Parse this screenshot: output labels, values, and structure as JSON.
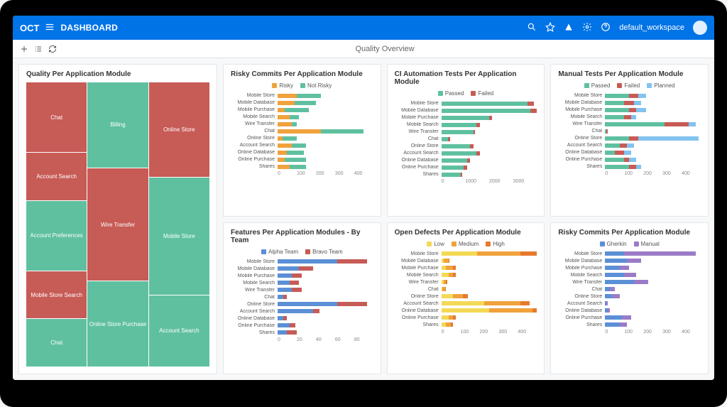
{
  "header": {
    "brand": "OCT",
    "title": "DASHBOARD",
    "workspace": "default_workspace"
  },
  "page": {
    "title": "Quality Overview"
  },
  "colors": {
    "red": "#c75b56",
    "green": "#5fc0a0",
    "orange": "#f0a23c",
    "blue": "#5b8fd6",
    "purple": "#9b7bc6",
    "yellow": "#f3d955",
    "lightblue": "#82c3f0",
    "darkorange": "#e67a2e"
  },
  "chart_data": [
    {
      "type": "treemap",
      "title": "Quality Per Application Module",
      "cells": [
        {
          "col": 0,
          "flex": 3,
          "label": "Chat",
          "color": "red"
        },
        {
          "col": 0,
          "flex": 2,
          "label": "Account Search",
          "color": "red"
        },
        {
          "col": 0,
          "flex": 3,
          "label": "Account Preferences",
          "color": "green"
        },
        {
          "col": 0,
          "flex": 2,
          "label": "Mobile Store Search",
          "color": "red"
        },
        {
          "col": 0,
          "flex": 2,
          "label": "Chat",
          "color": "green"
        },
        {
          "col": 1,
          "flex": 3,
          "label": "Billing",
          "color": "green"
        },
        {
          "col": 1,
          "flex": 4,
          "label": "Wire Transfer",
          "color": "red"
        },
        {
          "col": 1,
          "flex": 3,
          "label": "Online Store Purchase",
          "color": "green"
        },
        {
          "col": 2,
          "flex": 4,
          "label": "Online Store",
          "color": "red"
        },
        {
          "col": 2,
          "flex": 5,
          "label": "Mobile Store",
          "color": "green"
        },
        {
          "col": 2,
          "flex": 3,
          "label": "Account Search",
          "color": "green"
        }
      ]
    },
    {
      "type": "bar",
      "title": "Risky Commits Per Application Module",
      "legend": [
        {
          "name": "Risky",
          "color": "orange"
        },
        {
          "name": "Not Risky",
          "color": "green"
        }
      ],
      "categories": [
        "Mobile Store",
        "Mobile Database",
        "Mobile Purchase",
        "Mobile Search",
        "Wire Transfer",
        "Chat",
        "Online Store",
        "Account Search",
        "Online Database",
        "Online Purchase",
        "Shares"
      ],
      "series": [
        {
          "name": "Risky",
          "color": "orange",
          "values": [
            80,
            70,
            30,
            50,
            60,
            180,
            20,
            60,
            40,
            30,
            50
          ]
        },
        {
          "name": "Not Risky",
          "color": "green",
          "values": [
            100,
            90,
            100,
            40,
            20,
            180,
            60,
            60,
            70,
            90,
            70
          ]
        }
      ],
      "xlim": [
        0,
        400
      ],
      "ticks": [
        0,
        100,
        200,
        300,
        400
      ]
    },
    {
      "type": "bar",
      "title": "CI Automation Tests Per Application Module",
      "legend": [
        {
          "name": "Passed",
          "color": "green"
        },
        {
          "name": "Failed",
          "color": "red"
        }
      ],
      "categories": [
        "Mobile Store",
        "Mobile Database",
        "Mobile Purchase",
        "Mobile Search",
        "Wire Transfer",
        "Chat",
        "Online Store",
        "Account Search",
        "Online Database",
        "Online Purchase",
        "Shares"
      ],
      "series": [
        {
          "name": "Passed",
          "color": "green",
          "values": [
            2700,
            2800,
            1500,
            1100,
            1000,
            200,
            900,
            1100,
            800,
            700,
            600
          ]
        },
        {
          "name": "Failed",
          "color": "red",
          "values": [
            200,
            200,
            100,
            100,
            50,
            80,
            100,
            100,
            100,
            100,
            50
          ]
        }
      ],
      "xlim": [
        0,
        3000
      ],
      "ticks": [
        0,
        1000,
        2000,
        3000
      ]
    },
    {
      "type": "bar",
      "title": "Manual Tests Per Application Module",
      "legend": [
        {
          "name": "Passed",
          "color": "green"
        },
        {
          "name": "Failed",
          "color": "red"
        },
        {
          "name": "Planned",
          "color": "lightblue"
        }
      ],
      "categories": [
        "Mobile Store",
        "Mobile Database",
        "Mobile Purchase",
        "Mobile Search",
        "Wire Transfer",
        "Chat",
        "Online Store",
        "Account Search",
        "Online Database",
        "Online Purchase",
        "Shares"
      ],
      "series": [
        {
          "name": "Passed",
          "color": "green",
          "values": [
            100,
            80,
            100,
            80,
            250,
            5,
            100,
            60,
            40,
            80,
            100
          ]
        },
        {
          "name": "Failed",
          "color": "red",
          "values": [
            40,
            40,
            30,
            30,
            100,
            5,
            40,
            30,
            40,
            20,
            30
          ]
        },
        {
          "name": "Planned",
          "color": "lightblue",
          "values": [
            30,
            30,
            40,
            20,
            30,
            0,
            250,
            30,
            30,
            30,
            20
          ]
        }
      ],
      "xlim": [
        0,
        400
      ],
      "ticks": [
        0,
        100,
        200,
        300,
        400
      ]
    },
    {
      "type": "bar",
      "title": "Features Per Application Modules - By Team",
      "legend": [
        {
          "name": "Alpha Team",
          "color": "blue"
        },
        {
          "name": "Bravo Team",
          "color": "red"
        }
      ],
      "categories": [
        "Mobile Store",
        "Mobile Database",
        "Mobile Purchase",
        "Mobile Search",
        "Wire Transfer",
        "Chat",
        "Online Store",
        "Account Search",
        "Online Database",
        "Online Purchase",
        "Shares"
      ],
      "series": [
        {
          "name": "Alpha Team",
          "color": "blue",
          "values": [
            50,
            18,
            12,
            10,
            12,
            5,
            50,
            30,
            5,
            10,
            8
          ]
        },
        {
          "name": "Bravo Team",
          "color": "red",
          "values": [
            25,
            12,
            8,
            8,
            8,
            3,
            25,
            5,
            3,
            5,
            8
          ]
        }
      ],
      "xlim": [
        0,
        80
      ],
      "ticks": [
        0,
        20,
        40,
        60,
        80
      ]
    },
    {
      "type": "bar",
      "title": "Open Defects Per Application Module",
      "legend": [
        {
          "name": "Low",
          "color": "yellow"
        },
        {
          "name": "Medium",
          "color": "orange"
        },
        {
          "name": "High",
          "color": "darkorange"
        }
      ],
      "categories": [
        "Mobile Store",
        "Mobile Database",
        "Mobile Purchase",
        "Mobile Search",
        "Wire Transfer",
        "Chat",
        "Online Store",
        "Account Search",
        "Online Database",
        "Online Purchase",
        "Shares"
      ],
      "series": [
        {
          "name": "Low",
          "color": "yellow",
          "values": [
            150,
            10,
            20,
            30,
            10,
            5,
            50,
            180,
            200,
            30,
            20
          ]
        },
        {
          "name": "Medium",
          "color": "orange",
          "values": [
            180,
            20,
            30,
            20,
            10,
            10,
            40,
            150,
            180,
            20,
            20
          ]
        },
        {
          "name": "High",
          "color": "darkorange",
          "values": [
            70,
            5,
            10,
            10,
            5,
            5,
            20,
            40,
            20,
            10,
            10
          ]
        }
      ],
      "xlim": [
        0,
        400
      ],
      "ticks": [
        0,
        100,
        200,
        300,
        400
      ]
    },
    {
      "type": "bar",
      "title": "Risky Commits Per Application Module",
      "legend": [
        {
          "name": "Gherkin",
          "color": "blue"
        },
        {
          "name": "Manual",
          "color": "purple"
        }
      ],
      "categories": [
        "Mobile Store",
        "Mobile Database",
        "Mobile Purchase",
        "Mobile Search",
        "Wire Transfer",
        "Chat",
        "Online Store",
        "Account Search",
        "Online Database",
        "Online Purchase",
        "Shares"
      ],
      "series": [
        {
          "name": "Gherkin",
          "color": "blue",
          "values": [
            80,
            90,
            60,
            80,
            120,
            20,
            30,
            5,
            10,
            70,
            60
          ]
        },
        {
          "name": "Manual",
          "color": "purple",
          "values": [
            300,
            60,
            40,
            50,
            60,
            20,
            30,
            5,
            10,
            40,
            30
          ]
        }
      ],
      "xlim": [
        0,
        400
      ],
      "ticks": [
        0,
        100,
        200,
        300,
        400
      ]
    }
  ]
}
